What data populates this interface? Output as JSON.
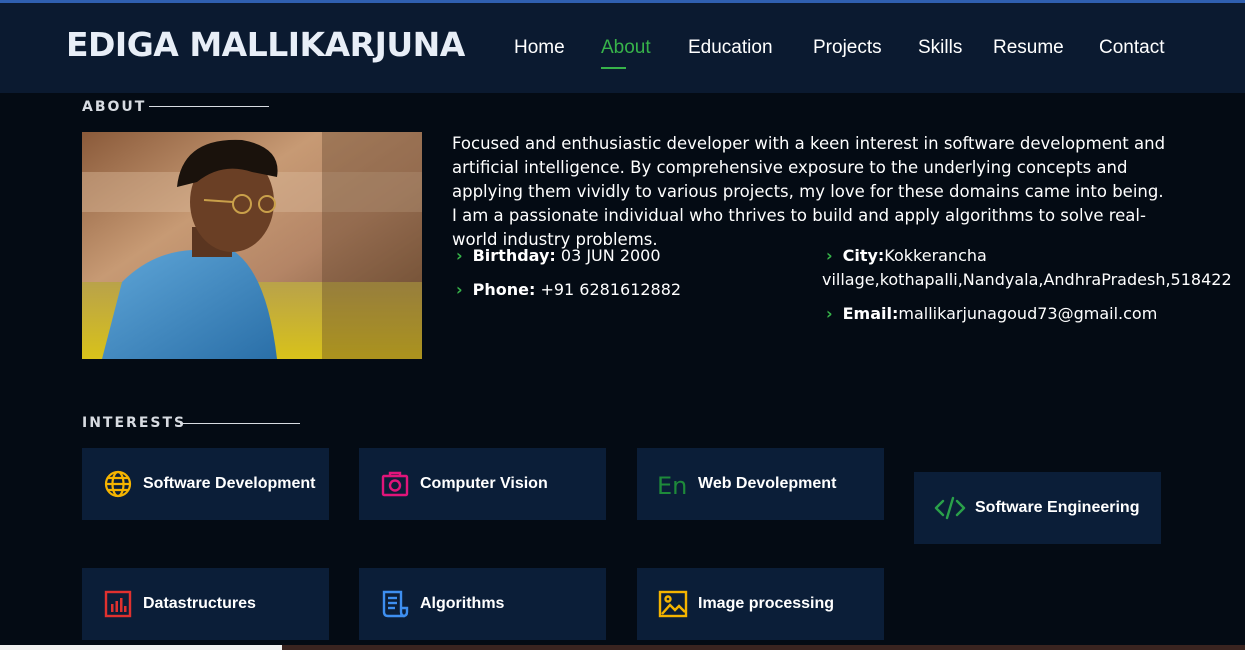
{
  "header": {
    "brand": "EDIGA MALLIKARJUNA",
    "nav": [
      "Home",
      "About",
      "Education",
      "Projects",
      "Skills",
      "Resume",
      "Contact"
    ],
    "active_nav": "About"
  },
  "about": {
    "section_title": "ABOUT",
    "bio": "Focused and enthusiastic developer with a keen interest in software development and artificial intelligence. By comprehensive exposure to the underlying concepts and applying them vividly to various projects, my love for these domains came into being. I am a passionate individual who thrives to build and apply algorithms to solve real-world industry problems.",
    "birthday_label": "Birthday:",
    "birthday_value": "03 JUN 2000",
    "phone_label": "Phone:",
    "phone_value": "+91 6281612882",
    "city_label": "City:",
    "city_value_line1": "Kokkerancha",
    "city_value_line2": "village,kothapalli,Nandyala,AndhraPradesh,518422",
    "email_label": "Email:",
    "email_value": "mallikarjunagoud73@gmail.com"
  },
  "interests": {
    "section_title": "INTERESTS",
    "items": [
      {
        "label": "Software Development",
        "icon": "globe-icon",
        "color": "#f5b400"
      },
      {
        "label": "Computer Vision",
        "icon": "camera-icon",
        "color": "#e0157a"
      },
      {
        "label": "Web Devolepment",
        "icon": "en-text-icon",
        "color": "#1e8a3a"
      },
      {
        "label": "Software Engineering",
        "icon": "code-icon",
        "color": "#2aa04a"
      },
      {
        "label": "Datastructures",
        "icon": "bar-chart-icon",
        "color": "#e0312f"
      },
      {
        "label": "Algorithms",
        "icon": "document-icon",
        "color": "#3e8ff0"
      },
      {
        "label": "Image processing",
        "icon": "image-icon",
        "color": "#f5b400"
      }
    ]
  }
}
